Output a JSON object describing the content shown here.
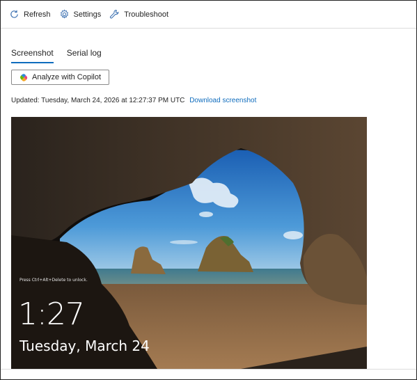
{
  "toolbar": {
    "refresh_label": "Refresh",
    "settings_label": "Settings",
    "troubleshoot_label": "Troubleshoot"
  },
  "tabs": [
    {
      "label": "Screenshot",
      "active": true
    },
    {
      "label": "Serial log",
      "active": false
    }
  ],
  "copilot_button": {
    "label": "Analyze with Copilot",
    "icon": "copilot-icon"
  },
  "status": {
    "updated_text": "Updated: Tuesday, March 24, 2026 at 12:27:37 PM UTC",
    "download_link": "Download screenshot"
  },
  "lock_screen": {
    "hint": "Press Ctrl+Alt+Delete to unlock.",
    "time": "1:27",
    "date": "Tuesday, March 24"
  },
  "colors": {
    "accent": "#0f6cbd",
    "text": "#242424",
    "border": "#dcdcdc"
  }
}
